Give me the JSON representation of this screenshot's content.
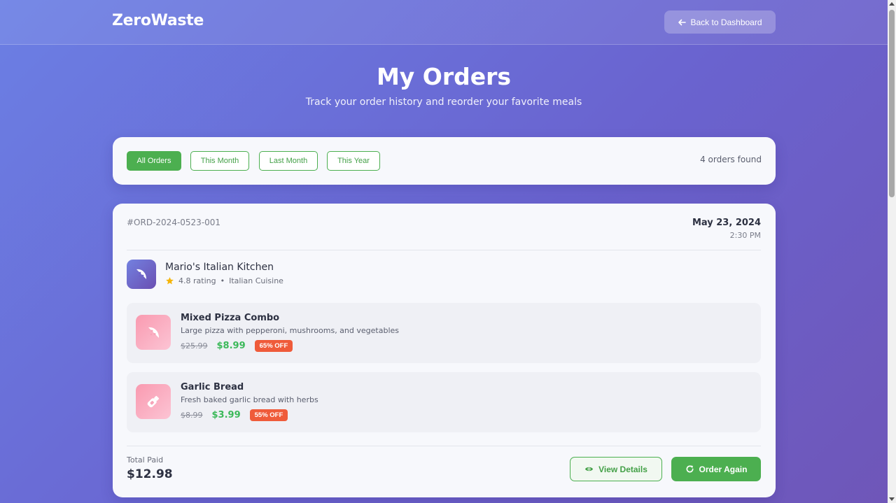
{
  "header": {
    "logo": "ZeroWaste",
    "back_label": "Back to Dashboard"
  },
  "hero": {
    "title": "My Orders",
    "subtitle": "Track your order history and reorder your favorite meals"
  },
  "filters": {
    "chips": [
      "All Orders",
      "This Month",
      "Last Month",
      "This Year"
    ],
    "active": "All Orders",
    "count_text": "4 orders found"
  },
  "order": {
    "id": "#ORD-2024-0523-001",
    "date": "May 23, 2024",
    "time": "2:30 PM",
    "restaurant": {
      "name": "Mario's Italian Kitchen",
      "rating": "4.8 rating",
      "separator": "•",
      "cuisine": "Italian Cuisine",
      "icon": "pizza-icon"
    },
    "items": [
      {
        "name": "Mixed Pizza Combo",
        "description": "Large pizza with pepperoni, mushrooms, and vegetables",
        "old_price": "$25.99",
        "new_price": "$8.99",
        "discount": "65% OFF",
        "icon": "pizza-slice-icon"
      },
      {
        "name": "Garlic Bread",
        "description": "Fresh baked garlic bread with herbs",
        "old_price": "$8.99",
        "new_price": "$3.99",
        "discount": "55% OFF",
        "icon": "bread-icon"
      }
    ],
    "total_label": "Total Paid",
    "total_value": "$12.98",
    "view_label": "View Details",
    "again_label": "Order Again"
  },
  "colors": {
    "accent_green": "#4caf50",
    "discount_red": "#ef5b3a",
    "price_green": "#3cb95a",
    "background_start": "#6b7fe4",
    "background_end": "#6f56b8"
  }
}
